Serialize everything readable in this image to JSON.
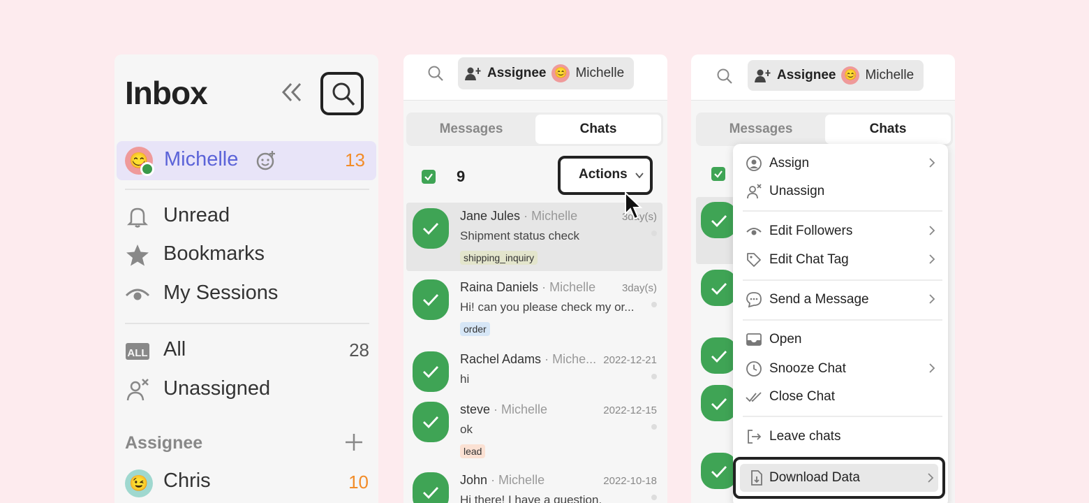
{
  "sidebar": {
    "title": "Inbox",
    "current_user": {
      "name": "Michelle",
      "count": "13",
      "avatar": "😋"
    },
    "nav": [
      {
        "label": "Unread",
        "icon": "bell-icon"
      },
      {
        "label": "Bookmarks",
        "icon": "star-icon"
      },
      {
        "label": "My Sessions",
        "icon": "eye-icon"
      }
    ],
    "views": [
      {
        "label": "All",
        "count": "28",
        "icon": "all-icon"
      },
      {
        "label": "Unassigned",
        "icon": "unassigned-icon"
      }
    ],
    "assignee_heading": "Assignee",
    "assignees": [
      {
        "name": "Chris",
        "count": "10",
        "avatar": "😉"
      }
    ]
  },
  "filter": {
    "label": "Assignee",
    "value": "Michelle",
    "avatar": "😊"
  },
  "tabs": {
    "messages": "Messages",
    "chats": "Chats"
  },
  "selection": {
    "count": "9",
    "actions_label": "Actions"
  },
  "chats": [
    {
      "name": "Jane Jules",
      "agent": "· Michelle",
      "date": "3day(s)",
      "message": "Shipment status check",
      "tag": "shipping_inquiry",
      "tag_color": "#e3e5cc"
    },
    {
      "name": "Raina Daniels",
      "agent": "· Michelle",
      "date": "3day(s)",
      "message": "Hi! can you please check my or...",
      "tag": "order",
      "tag_color": "#d6e6f6"
    },
    {
      "name": "Rachel Adams",
      "agent": "· Miche...",
      "date": "2022-12-21",
      "message": "hi"
    },
    {
      "name": "steve",
      "agent": "· Michelle",
      "date": "2022-12-15",
      "message": "ok",
      "tag": "lead",
      "tag_color": "#fbe1d3"
    },
    {
      "name": "John",
      "agent": "· Michelle",
      "date": "2022-10-18",
      "message": "Hi there! I have a question."
    }
  ],
  "menu": {
    "assign": "Assign",
    "unassign": "Unassign",
    "edit_followers": "Edit Followers",
    "edit_chat_tag": "Edit Chat Tag",
    "send_message": "Send a Message",
    "open": "Open",
    "snooze": "Snooze Chat",
    "close": "Close Chat",
    "leave": "Leave chats",
    "download": "Download Data"
  },
  "colors": {
    "background": "#fdebee",
    "accent": "#5b63d8",
    "count": "#f28c28",
    "check": "#3fa455",
    "selected_row": "#e8e4f8"
  }
}
